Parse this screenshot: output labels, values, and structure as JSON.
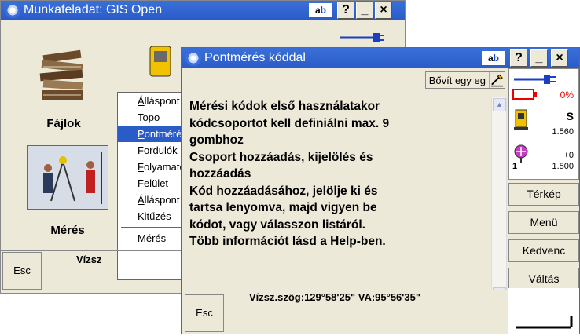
{
  "back_window": {
    "title": "Munkafeladat: GIS Open",
    "tiles": {
      "files": "Fájlok",
      "measure": "Mérés"
    },
    "menu": {
      "items": [
        {
          "label": "Álláspont",
          "underline": "Á"
        },
        {
          "label": "Topo",
          "underline": "T"
        },
        {
          "label": "Pontmérés",
          "underline": "P",
          "selected": true
        },
        {
          "label": "Fordulók",
          "underline": "F"
        },
        {
          "label": "Folyamatos",
          "underline": "F"
        },
        {
          "label": "Felület",
          "underline": "F"
        },
        {
          "label": "Álláspont",
          "underline": "Á"
        },
        {
          "label": "Kitűzés",
          "underline": "K"
        },
        {
          "label": "Mérés",
          "underline": "M"
        }
      ]
    },
    "esc_label": "Esc",
    "status_text": "Vízsz"
  },
  "front_window": {
    "title": "Pontmérés kóddal",
    "input_mode": "ab",
    "help_label": "?",
    "minimize_label": "_",
    "close_label": "×",
    "extend_button": "Bővít egy eg",
    "message_lines": [
      "Mérési kódok első használatakor",
      "kódcsoportot kell definiálni max. 9",
      "gombhoz",
      "Csoport hozzáadás, kijelölés és",
      "hozzáadás",
      "Kód hozzáadásához, jelölje ki és",
      "tartsa lenyomva, majd vigyen be",
      "kódot, vagy válasszon listáról.",
      "Több információt lásd a Help-ben."
    ],
    "status": {
      "battery": "0%",
      "target": "S",
      "target_height": "1.560",
      "prism_constant": "+0",
      "prism_height": "1.500",
      "prism_index": "1"
    },
    "side_buttons": [
      "Térkép",
      "Menü",
      "Kedvenc",
      "Váltás"
    ],
    "esc_label": "Esc",
    "angles": "Vízsz.szög:129°58'25\"  VA:95°56'35\""
  }
}
